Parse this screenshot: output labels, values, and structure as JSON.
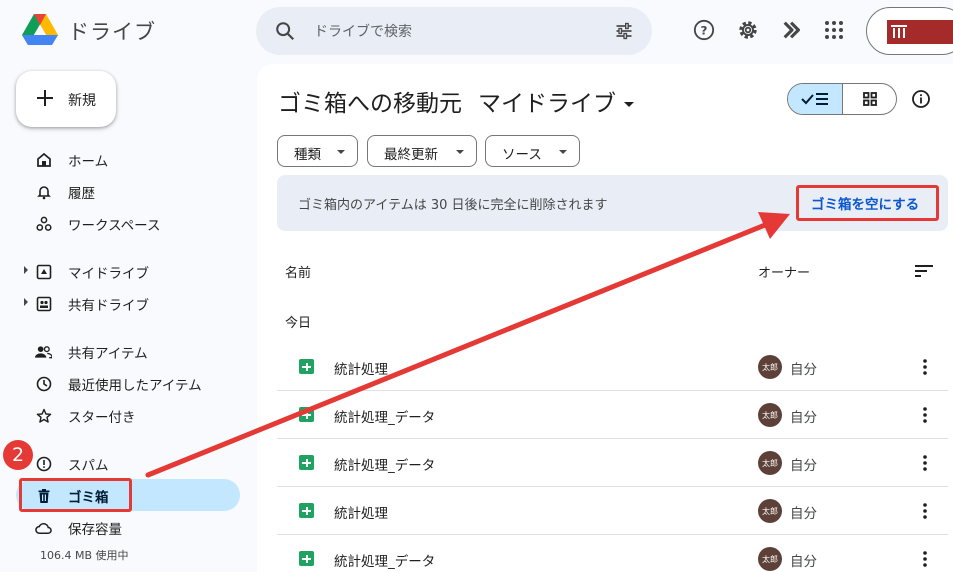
{
  "header": {
    "app_title": "ドライブ",
    "search_placeholder": "ドライブで検索"
  },
  "sidebar": {
    "new_label": "新規",
    "items": [
      {
        "label": "ホーム",
        "icon": "home-icon"
      },
      {
        "label": "履歴",
        "icon": "bell-icon"
      },
      {
        "label": "ワークスペース",
        "icon": "workspaces-icon"
      },
      {
        "label": "マイドライブ",
        "icon": "my-drive-icon"
      },
      {
        "label": "共有ドライブ",
        "icon": "shared-drives-icon"
      },
      {
        "label": "共有アイテム",
        "icon": "people-icon"
      },
      {
        "label": "最近使用したアイテム",
        "icon": "clock-icon"
      },
      {
        "label": "スター付き",
        "icon": "star-icon"
      },
      {
        "label": "スパム",
        "icon": "spam-icon"
      },
      {
        "label": "ゴミ箱",
        "icon": "trash-icon",
        "active": true
      },
      {
        "label": "保存容量",
        "icon": "cloud-icon"
      }
    ],
    "storage_used": "106.4 MB 使用中"
  },
  "annotation": {
    "step_number": "2",
    "color": "#e53935"
  },
  "main": {
    "title": "ゴミ箱への移動元",
    "location": "マイドライブ",
    "filters": [
      "種類",
      "最終更新",
      "ソース"
    ],
    "banner": {
      "message": "ゴミ箱内のアイテムは 30 日後に完全に削除されます",
      "empty_trash_label": "ゴミ箱を空にする"
    },
    "columns": {
      "name": "名前",
      "owner": "オーナー"
    },
    "section_label": "今日",
    "files": [
      {
        "name": "統計処理",
        "avatar": "太郎",
        "owner": "自分"
      },
      {
        "name": "統計処理_データ",
        "avatar": "太郎",
        "owner": "自分"
      },
      {
        "name": "統計処理_データ",
        "avatar": "太郎",
        "owner": "自分"
      },
      {
        "name": "統計処理",
        "avatar": "太郎",
        "owner": "自分"
      },
      {
        "name": "統計処理_データ",
        "avatar": "太郎",
        "owner": "自分"
      }
    ]
  },
  "colors": {
    "accent_blue": "#0b57d0",
    "active_bg": "#c2e7ff",
    "sheets_green": "#1ea362"
  }
}
